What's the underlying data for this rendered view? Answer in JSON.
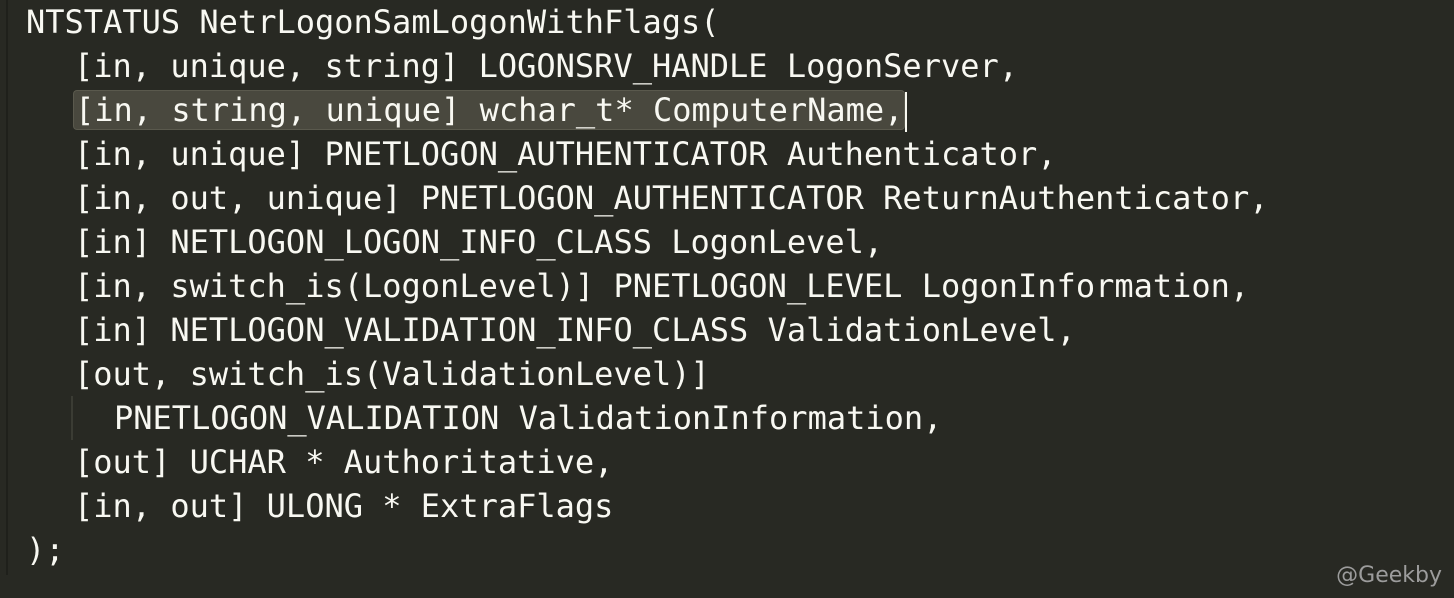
{
  "code": {
    "lines": [
      "NTSTATUS NetrLogonSamLogonWithFlags(",
      "[in, unique, string] LOGONSRV_HANDLE LogonServer,",
      "[in, string, unique] wchar_t* ComputerName,",
      "[in, unique] PNETLOGON_AUTHENTICATOR Authenticator,",
      "[in, out, unique] PNETLOGON_AUTHENTICATOR ReturnAuthenticator,",
      "[in] NETLOGON_LOGON_INFO_CLASS LogonLevel,",
      "[in, switch_is(LogonLevel)] PNETLOGON_LEVEL LogonInformation,",
      "[in] NETLOGON_VALIDATION_INFO_CLASS ValidationLevel,",
      "[out, switch_is(ValidationLevel)]",
      "PNETLOGON_VALIDATION ValidationInformation,",
      "[out] UCHAR * Authoritative,",
      "[in, out] ULONG * ExtraFlags",
      ");"
    ]
  },
  "watermark": "@Geekby",
  "colors": {
    "background": "#282923",
    "text": "#f8f8f2",
    "selection": "#49483e"
  }
}
